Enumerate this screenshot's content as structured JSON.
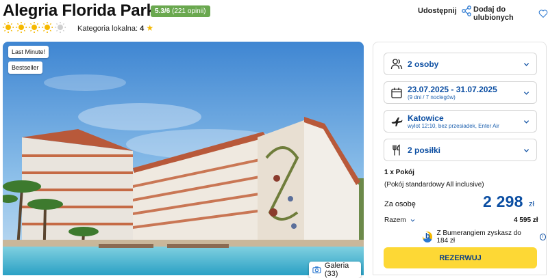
{
  "hotel": {
    "name": "Alegria Florida Park",
    "rating_score": "5.3/6",
    "rating_count": "(221 opinii)",
    "stars": 4,
    "stars_max": 5,
    "local_category_label": "Kategoria lokalna:",
    "local_category_value": "4"
  },
  "actions": {
    "share_label": "Udostępnij",
    "favorite_label": "Dodaj do ulubionych"
  },
  "photo": {
    "tags": [
      "Last Minute!",
      "Bestseller"
    ],
    "gallery_label": "Galeria (33)"
  },
  "booking": {
    "people": {
      "label": "2 osoby"
    },
    "dates": {
      "label": "23.07.2025 - 31.07.2025",
      "sub": "(9 dni / 7 noclegów)"
    },
    "flight": {
      "label": "Katowice",
      "sub": "wylot 12:10, bez przesiadek, Enter Air"
    },
    "meals": {
      "label": "2 posiłki"
    },
    "room_count": "1 x Pokój",
    "room_type": "(Pokój standardowy All inclusive)",
    "per_person_label": "Za osobę",
    "price_per_person": "2 298",
    "currency": "zł",
    "total_label": "Razem",
    "total_value": "4 595 zł",
    "bumerang_text": "Z Bumerangiem zyskasz do 184 zł",
    "reserve_label": "REZERWUJ"
  },
  "colors": {
    "accent_blue": "#0b4ea2",
    "rating_green": "#6aa84f",
    "reserve_yellow": "#fdd835",
    "star_yellow": "#f5b800"
  }
}
